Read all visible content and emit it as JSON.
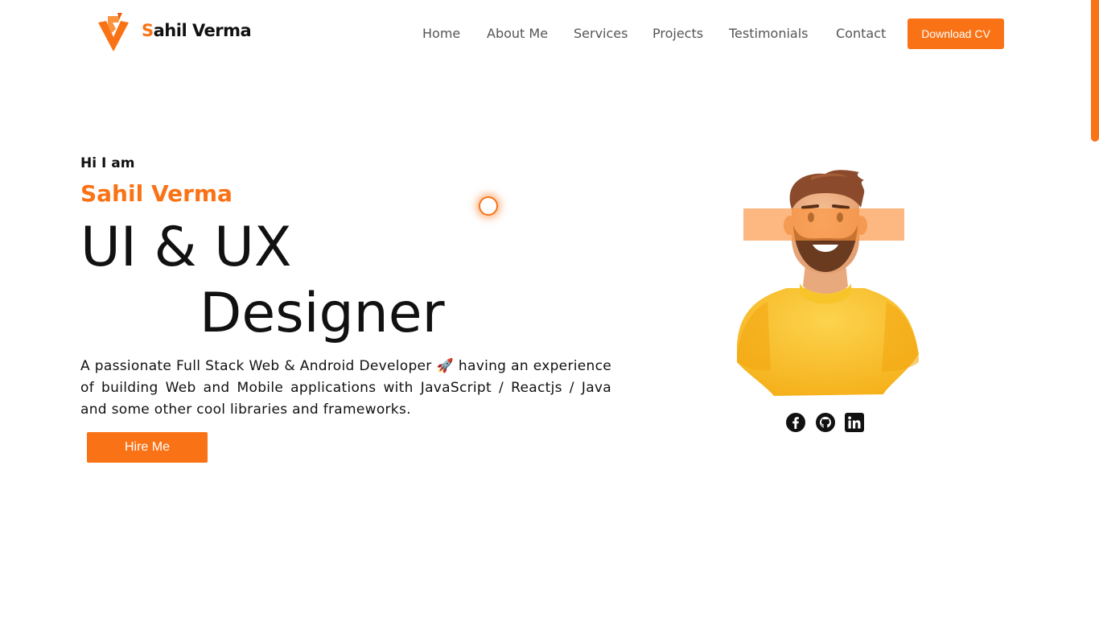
{
  "header": {
    "brand": {
      "first_letter": "S",
      "rest": "ahil Verma"
    },
    "nav": [
      {
        "label": "Home"
      },
      {
        "label": "About Me"
      },
      {
        "label": "Services"
      },
      {
        "label": "Projects"
      },
      {
        "label": "Testimonials"
      },
      {
        "label": "Contact"
      }
    ],
    "download_cv": "Download CV"
  },
  "hero": {
    "greeting": "Hi I am",
    "name": "Sahil Verma",
    "role_line1": "UI & UX",
    "role_line2": "Designer",
    "description": "A passionate Full Stack Web & Android Developer 🚀 having an experience of building Web and Mobile applications with JavaScript / Reactjs / Java and some other cool libraries and frameworks.",
    "hire_button": "Hire Me"
  },
  "social_icons": [
    "facebook-icon",
    "github-icon",
    "linkedin-icon"
  ],
  "colors": {
    "accent": "#f97316",
    "text": "#111111",
    "nav_text": "#555555"
  }
}
